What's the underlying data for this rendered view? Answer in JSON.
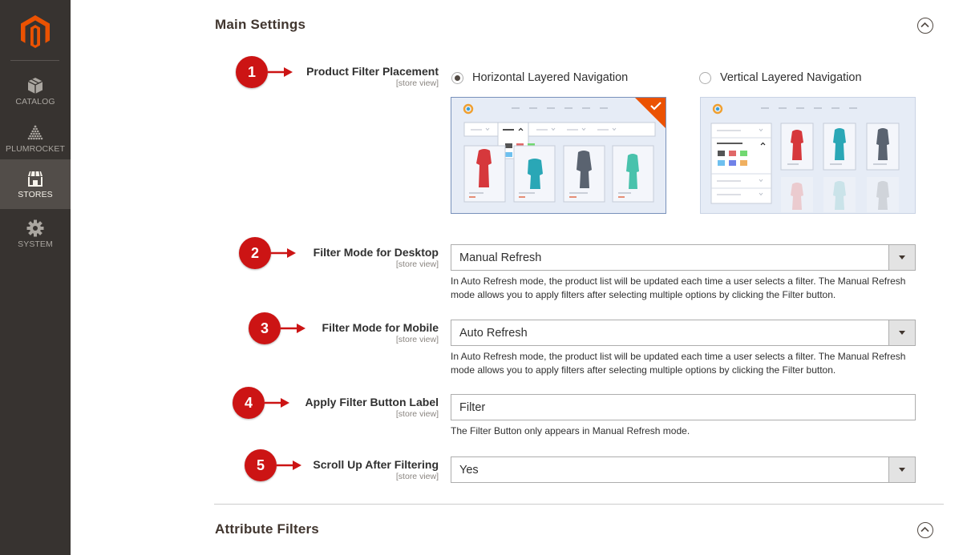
{
  "sidebar": {
    "items": [
      {
        "label": "CATALOG",
        "icon": "cube-icon",
        "active": false
      },
      {
        "label": "PLUMROCKET",
        "icon": "plumrocket-icon",
        "active": false
      },
      {
        "label": "STORES",
        "icon": "store-icon",
        "active": true
      },
      {
        "label": "SYSTEM",
        "icon": "gear-icon",
        "active": false
      }
    ]
  },
  "colors": {
    "sidebar": "#373330",
    "active_item": "#524d49",
    "badge": "#cc1414",
    "accent": "#eb5202"
  },
  "main_settings": {
    "title": "Main Settings",
    "fields": {
      "placement": {
        "badge": "1",
        "label": "Product Filter Placement",
        "scope": "[store view]",
        "options": [
          {
            "label": "Horizontal Layered Navigation",
            "checked": true
          },
          {
            "label": "Vertical Layered Navigation",
            "checked": false
          }
        ],
        "preview_logo": "LUMA"
      },
      "desktop_mode": {
        "badge": "2",
        "label": "Filter Mode for Desktop",
        "scope": "[store view]",
        "value": "Manual Refresh",
        "note": "In Auto Refresh mode, the product list will be updated each time a user selects a filter. The Manual Refresh mode allows you to apply filters after selecting multiple options by clicking the Filter button."
      },
      "mobile_mode": {
        "badge": "3",
        "label": "Filter Mode for Mobile",
        "scope": "[store view]",
        "value": "Auto Refresh",
        "note": "In Auto Refresh mode, the product list will be updated each time a user selects a filter. The Manual Refresh mode allows you to apply filters after selecting multiple options by clicking the Filter button."
      },
      "button_label": {
        "badge": "4",
        "label": "Apply Filter Button Label",
        "scope": "[store view]",
        "value": "Filter",
        "note": "The Filter Button only appears in Manual Refresh mode."
      },
      "scroll_up": {
        "badge": "5",
        "label": "Scroll Up After Filtering",
        "scope": "[store view]",
        "value": "Yes"
      }
    }
  },
  "attribute_filters": {
    "title": "Attribute Filters"
  }
}
